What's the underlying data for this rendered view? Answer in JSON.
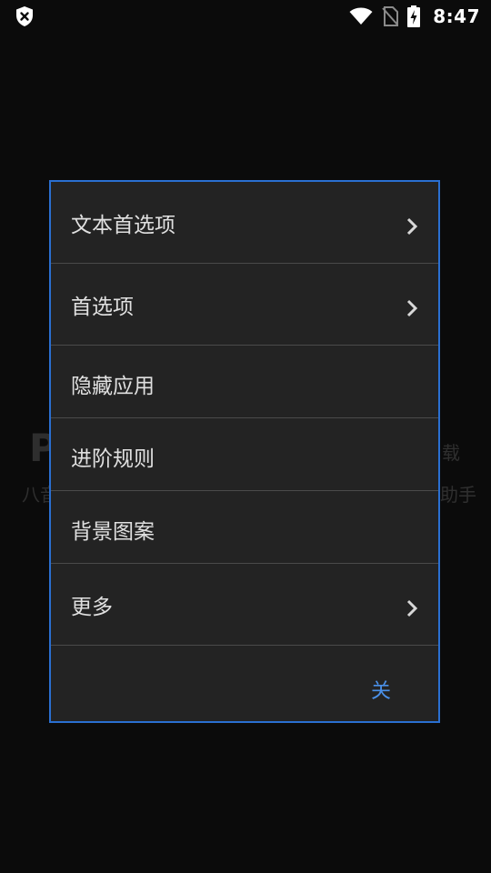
{
  "status_bar": {
    "time": "8:47",
    "left_icon": "shield-x-icon",
    "icons": [
      "wifi-icon",
      "no-sim-icon",
      "battery-charging-icon"
    ]
  },
  "background": {
    "title_left": "P",
    "subtitle_left": "八音",
    "title_right": "载",
    "subtitle_right": "助手"
  },
  "dialog": {
    "items": [
      {
        "label": "文本首选项",
        "has_submenu": true
      },
      {
        "label": "首选项",
        "has_submenu": true
      },
      {
        "label": "隐藏应用",
        "has_submenu": false
      },
      {
        "label": "进阶规则",
        "has_submenu": false
      },
      {
        "label": "背景图案",
        "has_submenu": false
      },
      {
        "label": "更多",
        "has_submenu": true
      }
    ],
    "close_label": "关"
  },
  "colors": {
    "accent": "#2a6fd1",
    "button_text": "#4a90e8",
    "dialog_bg": "#232323",
    "screen_bg": "#0b0b0b"
  }
}
